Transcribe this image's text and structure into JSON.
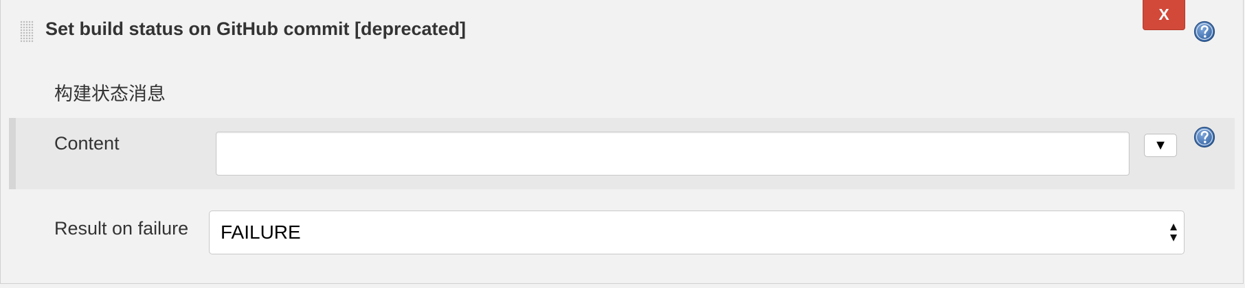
{
  "section": {
    "title": "Set build status on GitHub commit [deprecated]",
    "delete_label": "X"
  },
  "build_status_message": {
    "heading": "构建状态消息"
  },
  "content_field": {
    "label": "Content",
    "value": "",
    "placeholder": "",
    "expand_icon": "▼"
  },
  "result_on_failure": {
    "label": "Result on failure",
    "selected": "FAILURE"
  },
  "icons": {
    "help": "help-icon",
    "drag": "drag-handle-icon",
    "select_arrows": "select-arrows-icon"
  },
  "colors": {
    "delete_button": "#d24939",
    "help_icon": "#3b6fb4",
    "background": "#f2f2f2",
    "row_highlight": "#e8e8e8"
  }
}
